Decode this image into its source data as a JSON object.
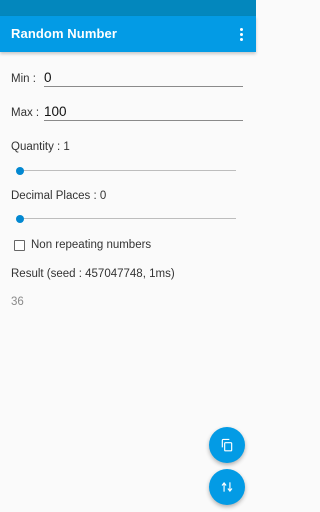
{
  "app": {
    "title": "Random Number",
    "colors": {
      "primary": "#039be5",
      "status_bar": "#0387bd",
      "accent": "#0288d1"
    }
  },
  "form": {
    "min_label": "Min :",
    "min_value": "0",
    "max_label": "Max :",
    "max_value": "100",
    "quantity_label": "Quantity : 1",
    "quantity_slider_value": 0,
    "decimal_label": "Decimal Places : 0",
    "decimal_slider_value": 0,
    "non_repeating_label": "Non repeating numbers",
    "non_repeating_checked": false
  },
  "result": {
    "label": "Result (seed : 457047748, 1ms)",
    "value": "36"
  },
  "icons": {
    "menu": "overflow-menu-icon",
    "copy": "copy-icon",
    "generate": "swap-vertical-icon"
  }
}
